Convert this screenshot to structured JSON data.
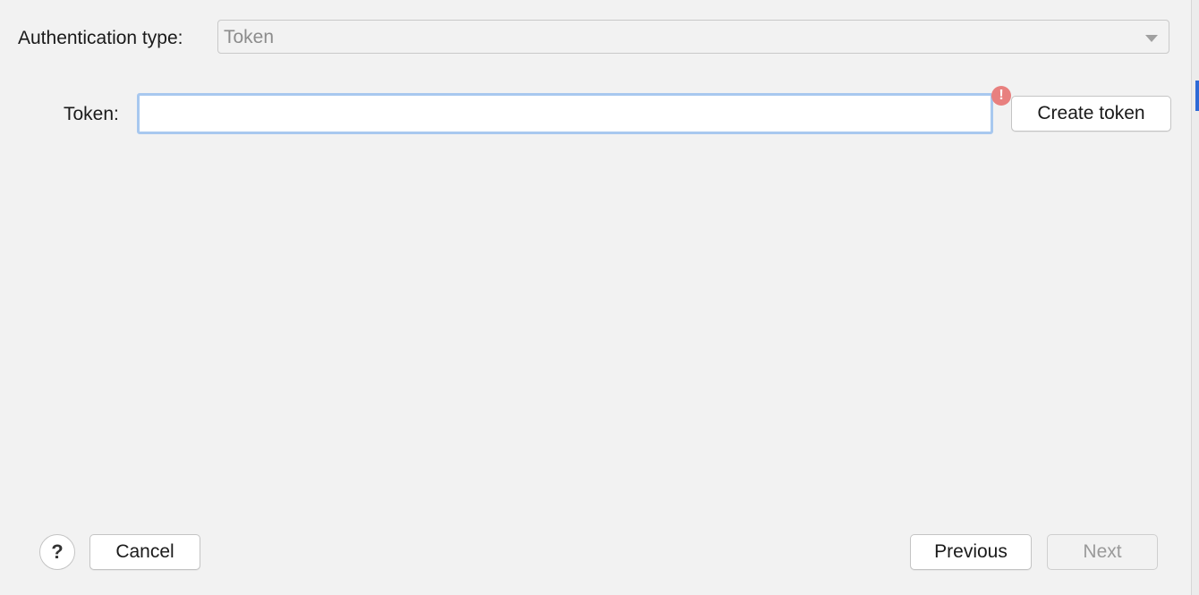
{
  "form": {
    "auth_type_label": "Authentication type:",
    "auth_type_value": "Token",
    "token_label": "Token:",
    "token_value": "",
    "create_token_label": "Create token",
    "error_icon": "!"
  },
  "footer": {
    "help_label": "?",
    "cancel_label": "Cancel",
    "previous_label": "Previous",
    "next_label": "Next"
  },
  "colors": {
    "background": "#f2f2f2",
    "focus_border": "#a8c8ef",
    "error": "#e8807f",
    "disabled_text": "#9a9a9a"
  }
}
